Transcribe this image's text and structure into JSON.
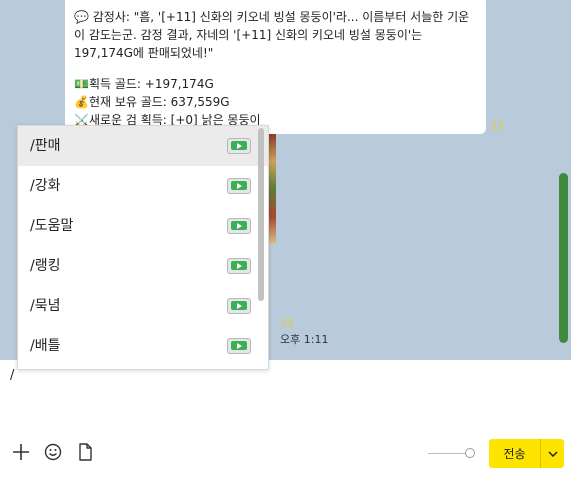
{
  "chat": {
    "message": {
      "line1": "💬 감정사: \"흠, '[+11] 신화의 키오네 빙설 몽둥이'라... 이름부터 서늘한 기운이 감도는군. 감정 결과, 자네의 '[+11] 신화의 키오네 빙설 몽둥이'는 197,174G에 판매되었네!\"",
      "line2": "💵획득 골드: +197,174G",
      "line3": "💰현재 보유 골드: 637,559G",
      "line4": "⚔️새로운 검 획득: [+0] 낡은 몽둥이"
    },
    "read_count_1": "11",
    "read_count_2": "11",
    "time": "오후 1:11"
  },
  "command_popup": {
    "items": [
      {
        "label": "/판매"
      },
      {
        "label": "/강화"
      },
      {
        "label": "/도움말"
      },
      {
        "label": "/랭킹"
      },
      {
        "label": "/묵념"
      },
      {
        "label": "/배틀"
      }
    ]
  },
  "input": {
    "value": "/"
  },
  "toolbar": {
    "send_label": "전송"
  },
  "icons": {
    "command_item": "ticket-icon",
    "toolbar": [
      "plus-icon",
      "emoji-icon",
      "file-icon"
    ],
    "send_menu": "chevron-down-icon"
  },
  "colors": {
    "chat_background": "#b9cadb",
    "send_button": "#fee500",
    "read_count": "#e7d200",
    "selected_item": "#ebebeb"
  }
}
